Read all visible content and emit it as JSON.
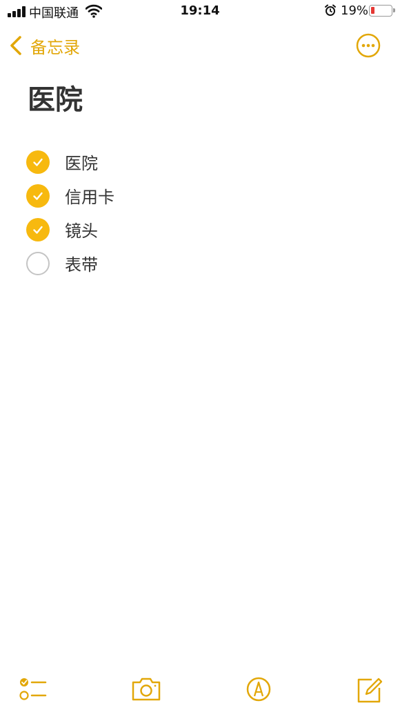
{
  "status_bar": {
    "carrier": "中国联通",
    "time": "19:14",
    "battery_percent": "19%",
    "battery_level": 0.19,
    "icons": [
      "signal-icon",
      "wifi-icon",
      "alarm-icon",
      "battery-icon"
    ]
  },
  "nav": {
    "back_label": "备忘录",
    "back_icon": "chevron-left-icon",
    "more_icon": "ellipsis-circle-icon",
    "accent_color": "#e2a708"
  },
  "note": {
    "title": "医院",
    "checklist": [
      {
        "label": "医院",
        "checked": true
      },
      {
        "label": "信用卡",
        "checked": true
      },
      {
        "label": "镜头",
        "checked": true
      },
      {
        "label": "表带",
        "checked": false
      }
    ]
  },
  "toolbar": {
    "icons": [
      "checklist-icon",
      "camera-icon",
      "markup-pen-icon",
      "compose-icon"
    ]
  }
}
